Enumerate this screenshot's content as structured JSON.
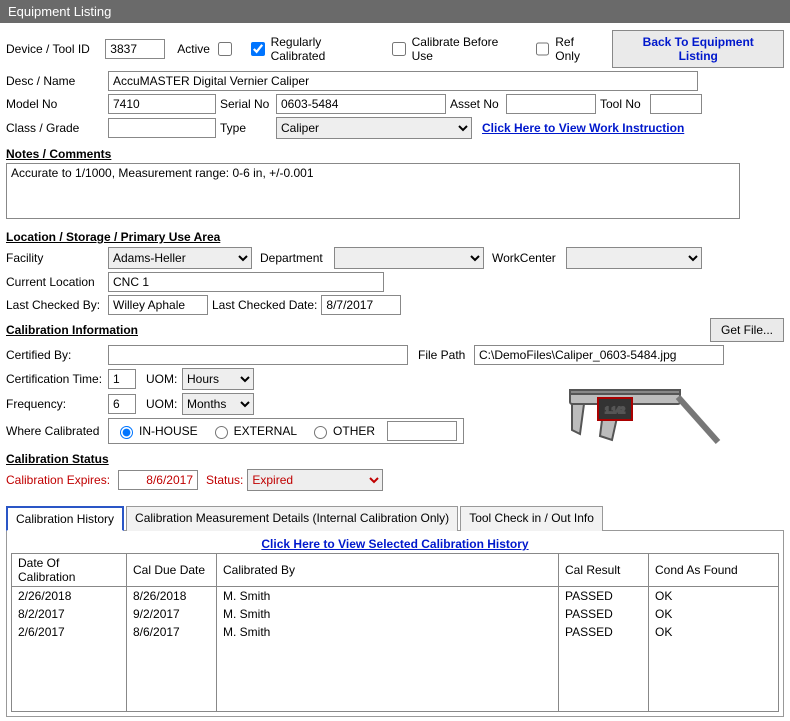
{
  "titlebar": "Equipment Listing",
  "labels": {
    "device_tool_id": "Device / Tool ID",
    "active": "Active",
    "regularly_calibrated": "Regularly Calibrated",
    "calibrate_before_use": "Calibrate Before Use",
    "ref_only": "Ref Only",
    "back_to_listing": "Back To Equipment Listing",
    "desc_name": "Desc / Name",
    "model_no": "Model No",
    "serial_no": "Serial No",
    "asset_no": "Asset No",
    "tool_no": "Tool No",
    "class_grade": "Class / Grade",
    "type": "Type",
    "view_work_instruction": "Click Here to View Work Instruction",
    "notes_comments": "Notes / Comments",
    "location_section": "Location / Storage / Primary Use Area",
    "facility": "Facility",
    "department": "Department",
    "workcenter": "WorkCenter",
    "current_location": "Current Location",
    "last_checked_by": "Last Checked By:",
    "last_checked_date": "Last Checked Date:",
    "calibration_info": "Calibration Information",
    "get_file": "Get File...",
    "certified_by": "Certified By:",
    "file_path": "File Path",
    "certification_time": "Certification Time:",
    "uom": "UOM:",
    "frequency": "Frequency:",
    "where_calibrated": "Where Calibrated",
    "in_house": "IN-HOUSE",
    "external": "EXTERNAL",
    "other": "OTHER",
    "calibration_status": "Calibration Status",
    "calibration_expires": "Calibration Expires:",
    "status": "Status:",
    "tab_history": "Calibration History",
    "tab_measurement": "Calibration Measurement Details (Internal Calibration Only)",
    "tab_checkin": "Tool Check in / Out Info",
    "view_selected_history": "Click Here to View Selected Calibration History",
    "col_date": "Date Of Calibration",
    "col_due": "Cal Due Date",
    "col_by": "Calibrated By",
    "col_result": "Cal Result",
    "col_cond": "Cond As Found"
  },
  "values": {
    "device_tool_id": "3837",
    "desc_name": "AccuMASTER Digital Vernier Caliper",
    "model_no": "7410",
    "serial_no": "0603-5484",
    "asset_no": "",
    "tool_no": "",
    "class_grade": "",
    "type": "Caliper",
    "notes": "Accurate to 1/1000, Measurement range: 0-6 in, +/-0.001",
    "facility": "Adams-Heller",
    "department": "",
    "workcenter": "",
    "current_location": "CNC 1",
    "last_checked_by": "Willey Aphale",
    "last_checked_date": "8/7/2017",
    "certified_by": "",
    "file_path": "C:\\DemoFiles\\Caliper_0603-5484.jpg",
    "certification_time": "1",
    "cert_time_uom": "Hours",
    "frequency": "6",
    "frequency_uom": "Months",
    "where_other_text": "",
    "calibration_expires": "8/6/2017",
    "status_val": "Expired"
  },
  "checks": {
    "active": false,
    "regularly_calibrated": true,
    "calibrate_before_use": false,
    "ref_only": false
  },
  "history": [
    {
      "date": "2/26/2018",
      "due": "8/26/2018",
      "by": "M. Smith",
      "result": "PASSED",
      "cond": "OK"
    },
    {
      "date": "8/2/2017",
      "due": "9/2/2017",
      "by": "M. Smith",
      "result": "PASSED",
      "cond": "OK"
    },
    {
      "date": "2/6/2017",
      "due": "8/6/2017",
      "by": "M. Smith",
      "result": "PASSED",
      "cond": "OK"
    }
  ]
}
